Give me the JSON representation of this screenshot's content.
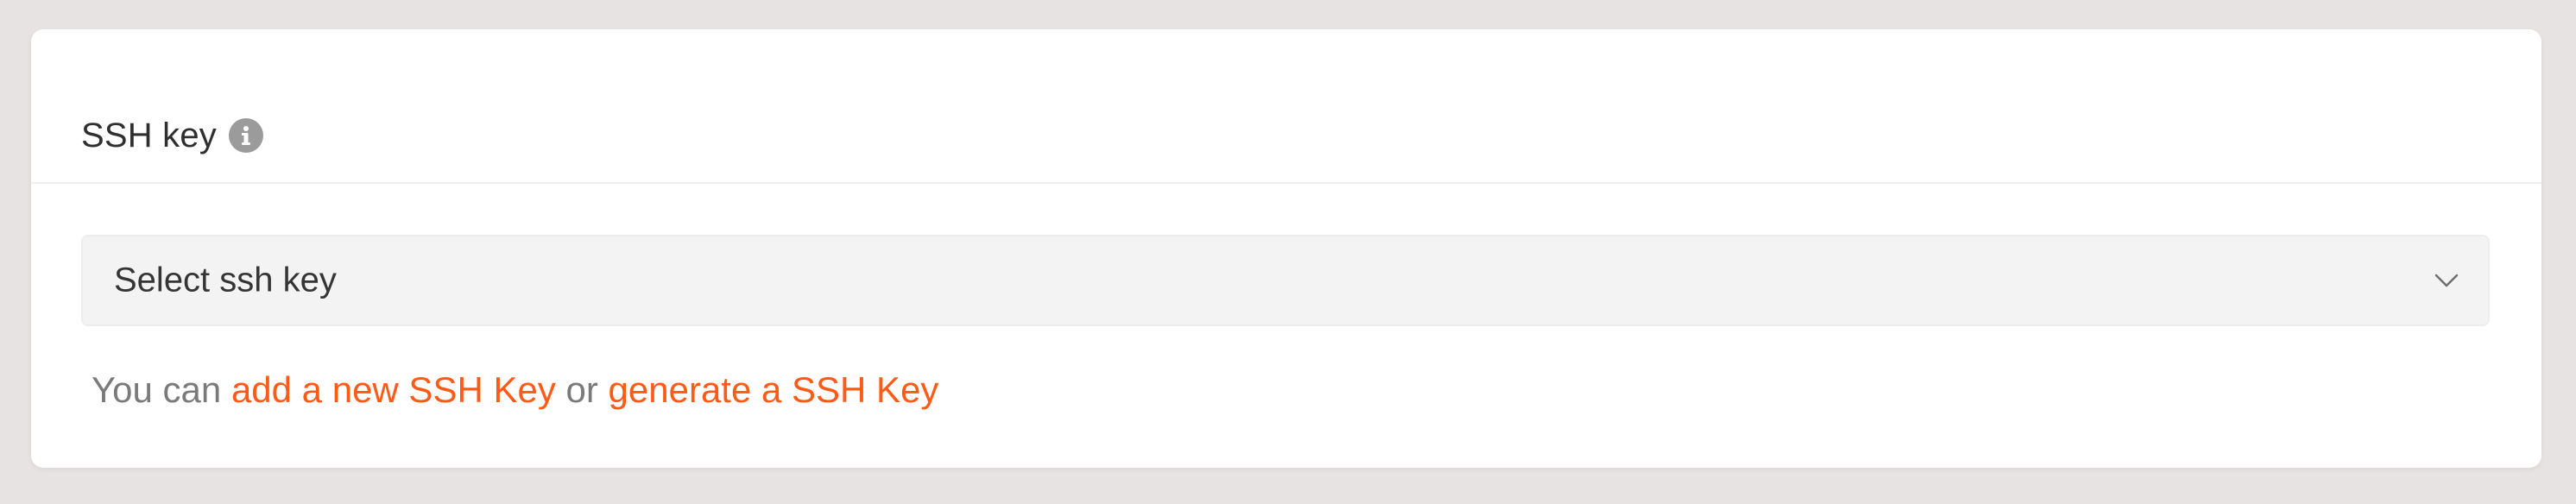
{
  "section": {
    "title": "SSH key",
    "info_icon": "info-icon"
  },
  "select": {
    "placeholder": "Select ssh key",
    "chevron_icon": "chevron-down-icon"
  },
  "help": {
    "prefix": "You can",
    "link_add": "add a new SSH Key",
    "middle": "or",
    "link_generate": "generate a SSH Key"
  },
  "colors": {
    "accent": "#ff5a16",
    "background": "#e6e3e2",
    "card": "#ffffff",
    "select_bg": "#f3f3f3",
    "muted_text": "#7a7a7a"
  }
}
